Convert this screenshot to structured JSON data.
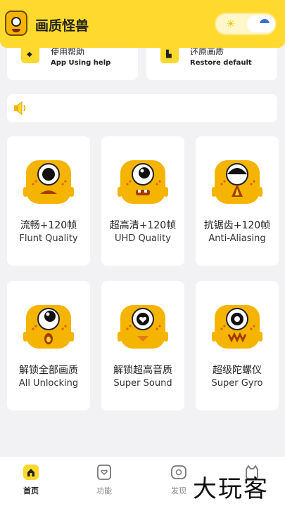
{
  "header": {
    "app_title": "画质怪兽",
    "mode_toggle": {
      "left_icon": "sun-icon",
      "right_icon": "moon-icon"
    }
  },
  "top_cards": [
    {
      "title": "使用帮助",
      "subtitle": "App Using help",
      "icon": "help-icon"
    },
    {
      "title": "还原画质",
      "subtitle": "Restore default",
      "icon": "restore-icon"
    }
  ],
  "notice": {
    "icon": "speaker-icon",
    "text": ""
  },
  "features": [
    {
      "cn": "流畅+120帧",
      "en": "Flunt Quality"
    },
    {
      "cn": "超高清+120帧",
      "en": "UHD Quality"
    },
    {
      "cn": "抗锯齿+120帧",
      "en": "Anti-Aliasing"
    },
    {
      "cn": "解锁全部画质",
      "en": "All Unlocking"
    },
    {
      "cn": "解锁超高音质",
      "en": "Super Sound"
    },
    {
      "cn": "超级陀螺仪",
      "en": "Super Gyro"
    }
  ],
  "bottom_nav": [
    {
      "label": "首页",
      "icon": "home-icon",
      "active": true
    },
    {
      "label": "功能",
      "icon": "bookmark-icon",
      "active": false
    },
    {
      "label": "发现",
      "icon": "discover-icon",
      "active": false
    },
    {
      "label": "",
      "icon": "profile-icon",
      "active": false
    }
  ],
  "watermark": "大玩客",
  "colors": {
    "accent": "#ffd92e",
    "monster": "#f5b400",
    "background": "#f2f2f4"
  }
}
